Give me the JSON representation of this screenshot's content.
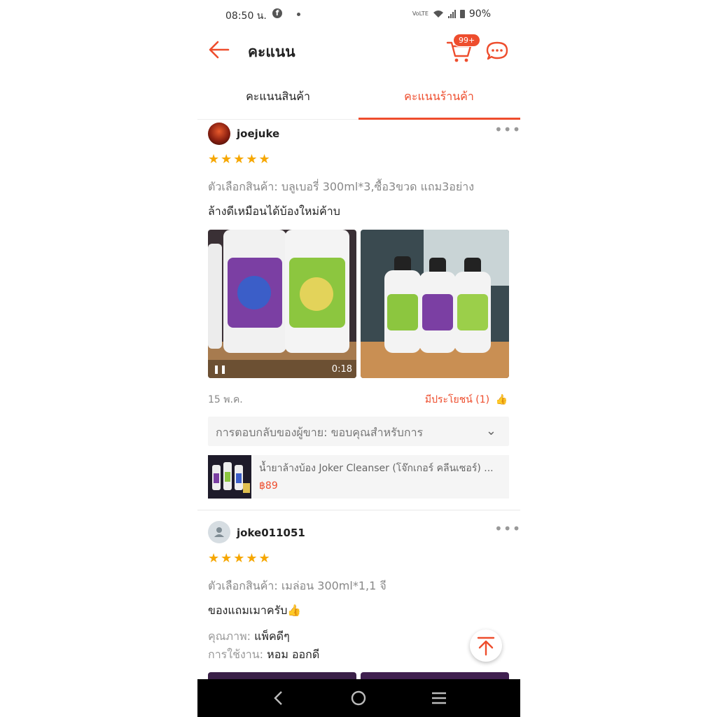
{
  "status_bar": {
    "time": "08:50 น.",
    "battery": "90%",
    "network_label": "VoLTE"
  },
  "header": {
    "title": "คะแนน",
    "cart_badge": "99+"
  },
  "tabs": [
    {
      "label": "คะแนนสินค้า",
      "active": false
    },
    {
      "label": "คะแนนร้านค้า",
      "active": true
    }
  ],
  "reviews": [
    {
      "username": "joejuke",
      "rating": 5,
      "variant": "ตัวเลือกสินค้า: บลูเบอรี่ 300ml*3,ซื้อ3ขวด แถม3อย่าง",
      "comment": "ล้างดีเหมือนได้บ้องใหม่ค้าบ",
      "video_duration": "0:18",
      "date": "15 พ.ค.",
      "helpful": "มีประโยชน์ (1)",
      "seller_reply": "การตอบกลับของผู้ขาย: ขอบคุณสำหรับการ",
      "product_name": "น้ำยาล้างบ้อง Joker Cleanser (โจ๊กเกอร์ คลีนเซอร์) ...",
      "product_price": "฿89"
    },
    {
      "username": "joke011051",
      "rating": 5,
      "variant": "ตัวเลือกสินค้า: เมล่อน 300ml*1,1 จี",
      "comment": "ของแถมเมาครับ👍",
      "quality_label": "คุณภาพ:",
      "quality_value": "แพ็คดีๆ",
      "usage_label": "การใช้งาน:",
      "usage_value": "หอม ออกดี"
    }
  ],
  "colors": {
    "accent": "#ee4d2d",
    "star": "#f6a700"
  },
  "icons": [
    "back-arrow-icon",
    "cart-icon",
    "chat-icon",
    "more-icon",
    "thumbs-up-icon",
    "chevron-down-icon",
    "scroll-to-top-icon",
    "nav-back-icon",
    "nav-home-icon",
    "nav-recents-icon"
  ]
}
